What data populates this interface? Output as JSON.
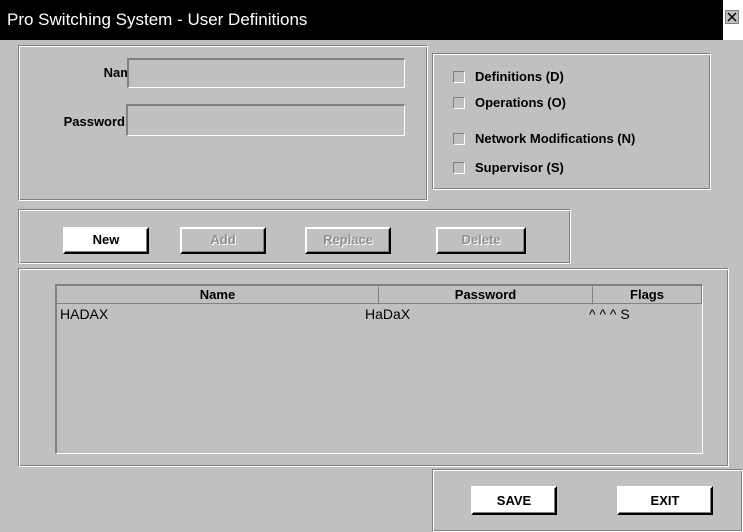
{
  "window": {
    "title": "Pro Switching System - User Definitions",
    "close_icon": "close-x-icon"
  },
  "form": {
    "name_label": "Name",
    "name_value": "",
    "password_label": "Password",
    "password_value": ""
  },
  "permissions": [
    {
      "label": "Definitions (D)",
      "checked": false
    },
    {
      "label": "Operations (O)",
      "checked": false
    },
    {
      "label": "Network Modifications (N)",
      "checked": false
    },
    {
      "label": "Supervisor (S)",
      "checked": false
    }
  ],
  "actions": {
    "new_label": "New",
    "add_label": "Add",
    "replace_label": "Replace",
    "delete_label": "Delete"
  },
  "user_list": {
    "columns": [
      "Name",
      "Password",
      "Flags"
    ],
    "rows": [
      {
        "name": "HADAX",
        "password": "HaDaX",
        "flags": "^ ^ ^ S"
      }
    ]
  },
  "footer": {
    "save_label": "SAVE",
    "exit_label": "EXIT"
  },
  "colors": {
    "window_bg": "#c0c0c0",
    "titlebar_bg": "#000000",
    "titlebar_text": "#ffffff"
  }
}
